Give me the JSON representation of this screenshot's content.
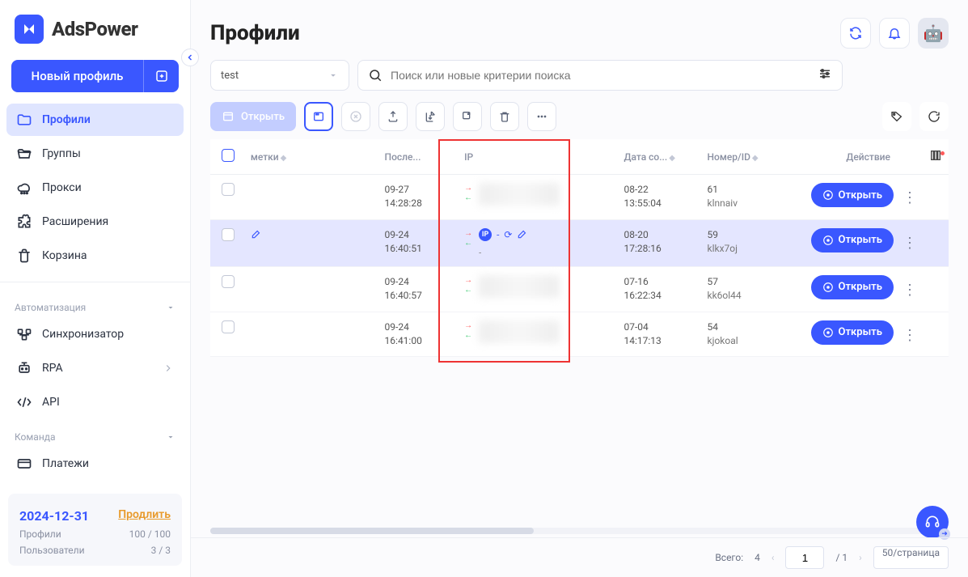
{
  "brand": "AdsPower",
  "sidebar": {
    "new_profile_label": "Новый профиль",
    "nav": {
      "profiles": "Профили",
      "groups": "Группы",
      "proxy": "Прокси",
      "extensions": "Расширения",
      "trash": "Корзина"
    },
    "section_automation": "Автоматизация",
    "automation": {
      "synchronizer": "Синхронизатор",
      "rpa": "RPA",
      "api": "API"
    },
    "section_team": "Команда",
    "team": {
      "payments": "Платежи"
    },
    "footer": {
      "date": "2024-12-31",
      "renew": "Продлить",
      "profiles_label": "Профили",
      "profiles_value": "100 / 100",
      "users_label": "Пользователи",
      "users_value": "3 / 3"
    }
  },
  "header": {
    "title": "Профили"
  },
  "filters": {
    "group_selected": "test",
    "search_placeholder": "Поиск или новые критерии поиска"
  },
  "toolbar": {
    "open_label": "Открыть"
  },
  "columns": {
    "tag": "метки",
    "last": "После...",
    "ip": "IP",
    "created": "Дата со...",
    "id": "Номер/ID",
    "action": "Действие"
  },
  "rows": [
    {
      "last1": "09-27",
      "last2": "14:28:28",
      "created1": "08-22",
      "created2": "13:55:04",
      "num": "61",
      "id": "klnnaiv",
      "open": "Открыть",
      "showicons": false
    },
    {
      "last1": "09-24",
      "last2": "16:40:51",
      "created1": "08-20",
      "created2": "17:28:16",
      "num": "59",
      "id": "klkx7oj",
      "open": "Открыть",
      "showicons": true,
      "hovered": true
    },
    {
      "last1": "09-24",
      "last2": "16:40:57",
      "created1": "07-16",
      "created2": "16:22:34",
      "num": "57",
      "id": "kk6ol44",
      "open": "Открыть",
      "showicons": false
    },
    {
      "last1": "09-24",
      "last2": "16:41:00",
      "created1": "07-04",
      "created2": "14:17:13",
      "num": "54",
      "id": "kjokoal",
      "open": "Открыть",
      "showicons": false
    }
  ],
  "pagination": {
    "total_label": "Всего:",
    "total_value": "4",
    "page": "1",
    "pages": "/ 1",
    "page_size": "50/страница"
  },
  "ip_dash": "-"
}
